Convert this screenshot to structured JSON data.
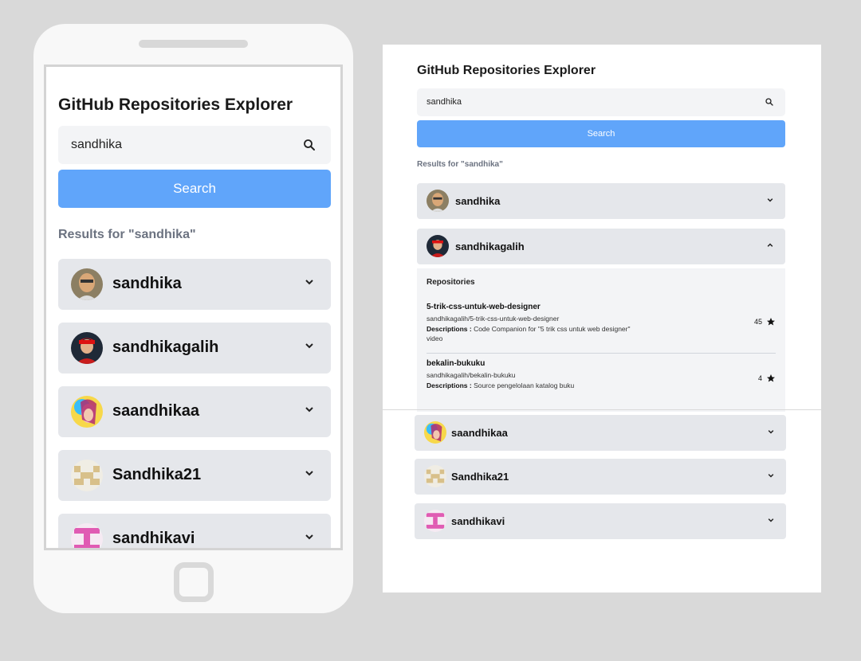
{
  "app": {
    "title": "GitHub Repositories Explorer",
    "search_value": "sandhika",
    "search_button": "Search",
    "results_text": "Results for \"sandhika\""
  },
  "users": [
    {
      "name": "sandhika",
      "expanded": false
    },
    {
      "name": "sandhikagalih",
      "expanded": true
    },
    {
      "name": "saandhikaa",
      "expanded": false
    },
    {
      "name": "Sandhika21",
      "expanded": false
    },
    {
      "name": "sandhikavi",
      "expanded": false
    }
  ],
  "repositories_panel": {
    "title": "Repositories",
    "repos": [
      {
        "name": "5-trik-css-untuk-web-designer",
        "full_name": "sandhikagalih/5-trik-css-untuk-web-designer",
        "desc_label": "Descriptions :",
        "description": "Code Companion for \"5 trik css untuk web designer\" video",
        "stars": "45"
      },
      {
        "name": "bekalin-bukuku",
        "full_name": "sandhikagalih/bekalin-bukuku",
        "desc_label": "Descriptions :",
        "description": "Source pengelolaan katalog buku",
        "stars": "4"
      }
    ]
  },
  "icons": {
    "search": "search-icon",
    "chevron_down": "chevron-down-icon",
    "chevron_up": "chevron-up-icon",
    "star": "star-icon"
  },
  "colors": {
    "accent": "#60a5fa",
    "card": "#e5e7eb",
    "input": "#f3f4f6",
    "background": "#d9d9d9"
  }
}
